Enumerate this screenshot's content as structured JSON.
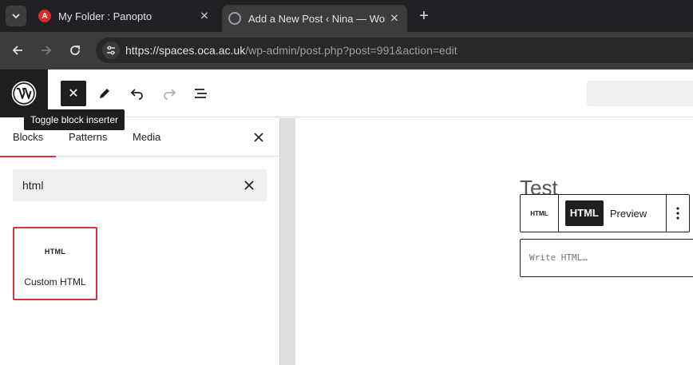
{
  "browser": {
    "tabs": [
      {
        "title": "My Folder : Panopto",
        "favicon": "A",
        "active": false
      },
      {
        "title": "Add a New Post ‹ Nina — WordPress",
        "favicon": "globe",
        "active": true
      }
    ],
    "close_glyph": "✕",
    "new_tab_glyph": "+",
    "url_host": "https://spaces.oca.ac.uk",
    "url_path": "/wp-admin/post.php?post=991&action=edit"
  },
  "editor_header": {
    "inserter_close_glyph": "✕",
    "tooltip": "Toggle block inserter"
  },
  "inserter": {
    "tabs": [
      "Blocks",
      "Patterns",
      "Media"
    ],
    "search_value": "html",
    "results": [
      {
        "icon_text": "HTML",
        "label": "Custom HTML"
      }
    ]
  },
  "canvas": {
    "post_title": "Test",
    "block_toolbar": {
      "type_icon_text": "HTML",
      "html_tab": "HTML",
      "preview_tab": "Preview"
    },
    "html_placeholder": "Write HTML…"
  },
  "colors": {
    "accent": "#d63638",
    "dark": "#1e1e1e",
    "browser_bg": "#202124",
    "toolbar_bg": "#3c3c3c"
  }
}
